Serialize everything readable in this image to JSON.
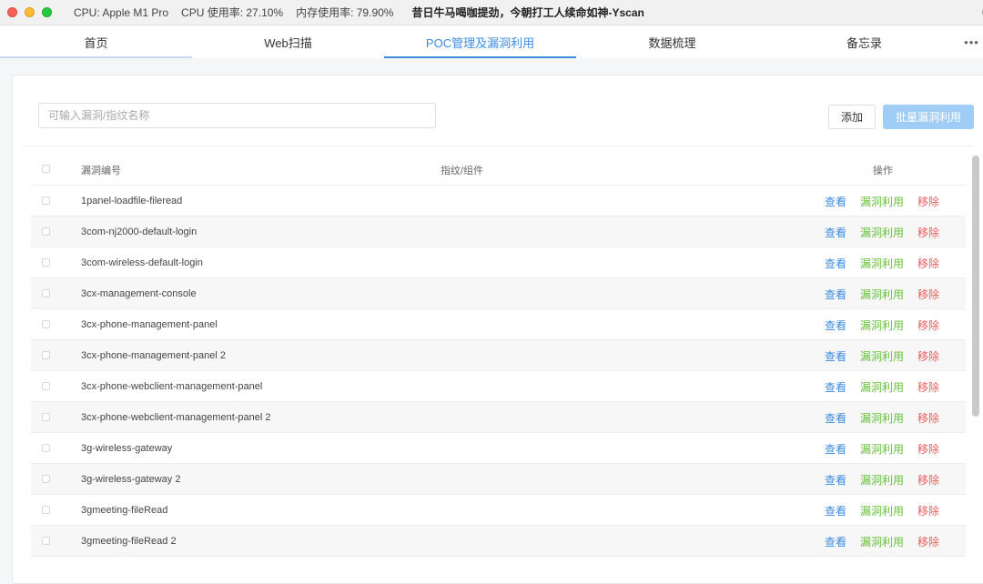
{
  "titlebar": {
    "cpu": "CPU: Apple M1 Pro",
    "cpu_usage": "CPU 使用率: 27.10%",
    "mem_usage": "内存使用率: 79.90%",
    "title": "昔日牛马喝咖提劲，今朝打工人续命如神-Yscan"
  },
  "tabs": [
    {
      "label": "首页"
    },
    {
      "label": "Web扫描"
    },
    {
      "label": "POC管理及漏洞利用"
    },
    {
      "label": "数据梳理"
    },
    {
      "label": "备忘录"
    }
  ],
  "more_label": "•••",
  "toolbar": {
    "search_placeholder": "可输入漏洞/指纹名称",
    "add_label": "添加",
    "batch_label": "批量漏洞利用"
  },
  "table": {
    "headers": {
      "id": "漏洞编号",
      "fingerprint": "指纹/组件",
      "actions": "操作"
    },
    "action_labels": {
      "view": "查看",
      "exploit": "漏洞利用",
      "remove": "移除"
    },
    "rows": [
      {
        "name": "1panel-loadfile-fileread"
      },
      {
        "name": "3com-nj2000-default-login"
      },
      {
        "name": "3com-wireless-default-login"
      },
      {
        "name": "3cx-management-console"
      },
      {
        "name": "3cx-phone-management-panel"
      },
      {
        "name": "3cx-phone-management-panel 2"
      },
      {
        "name": "3cx-phone-webclient-management-panel"
      },
      {
        "name": "3cx-phone-webclient-management-panel 2"
      },
      {
        "name": "3g-wireless-gateway"
      },
      {
        "name": "3g-wireless-gateway 2"
      },
      {
        "name": "3gmeeting-fileRead"
      },
      {
        "name": "3gmeeting-fileRead 2"
      }
    ]
  }
}
